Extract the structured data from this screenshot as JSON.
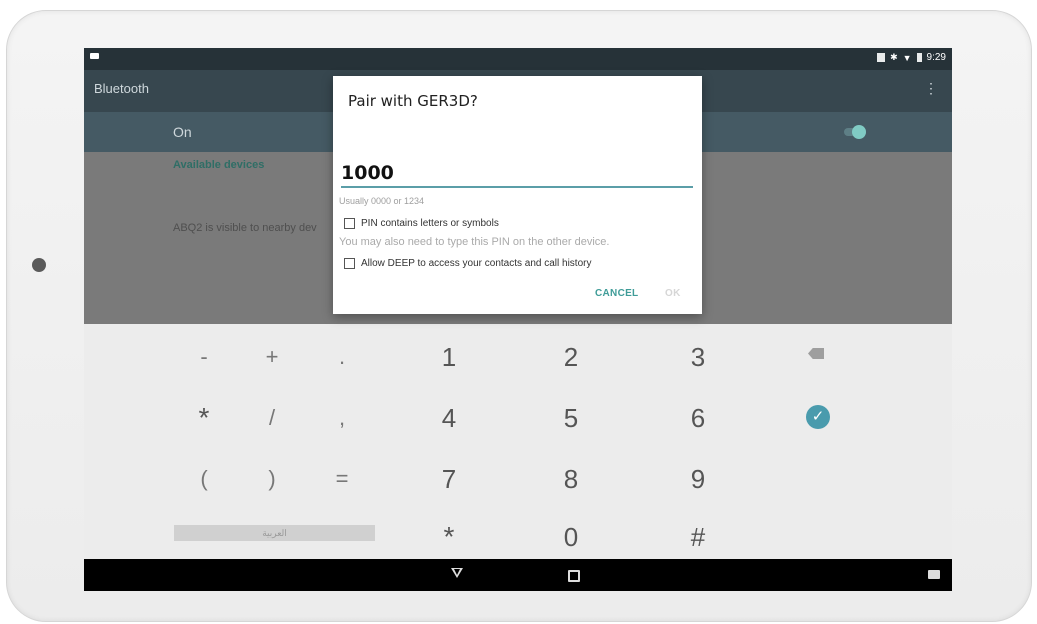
{
  "status_bar": {
    "time": "9:29"
  },
  "app_bar": {
    "title": "Bluetooth",
    "menu_icon": "overflow-menu-icon"
  },
  "bluetooth_toggle": {
    "label": "On",
    "state": "on"
  },
  "content": {
    "available_devices_header": "Available devices",
    "visible_text": "ABQ2 is visible to nearby dev"
  },
  "dialog": {
    "title": "Pair with GER3D?",
    "pin_value": "1000",
    "hint": "Usually 0000 or 1234",
    "pin_letters_label": "PIN contains letters or symbols",
    "also_text": "You may also need to type this PIN on the other device.",
    "allow_contacts_label": "Allow DEEP to access your contacts and call history",
    "cancel_label": "CANCEL",
    "ok_label": "OK"
  },
  "keyboard": {
    "row1": [
      "-",
      "+",
      ".",
      "1",
      "2",
      "3"
    ],
    "row2": [
      "*",
      "/",
      ",",
      "4",
      "5",
      "6"
    ],
    "row3": [
      "(",
      ")",
      "=",
      "7",
      "8",
      "9"
    ],
    "row4": [
      "*",
      "0",
      "#"
    ],
    "language": "العربية",
    "accent": "#4a9bad"
  },
  "colors": {
    "status_bar": "#263238",
    "app_bar": "#37474f",
    "toggle_bar": "#455a64",
    "accent": "#3f9c98"
  }
}
